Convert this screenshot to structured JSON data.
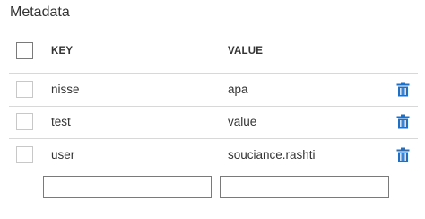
{
  "section": {
    "title": "Metadata"
  },
  "table": {
    "columns": [
      "KEY",
      "VALUE"
    ],
    "rows": [
      {
        "key": "nisse",
        "value": "apa"
      },
      {
        "key": "test",
        "value": "value"
      },
      {
        "key": "user",
        "value": "souciance.rashti"
      }
    ]
  },
  "new_entry": {
    "key_value": "",
    "value_value": "",
    "key_placeholder": "",
    "value_placeholder": ""
  },
  "colors": {
    "delete_icon": "#1f6fc5",
    "divider": "#d8d8d8"
  },
  "icons": {
    "delete": "trash-icon"
  }
}
